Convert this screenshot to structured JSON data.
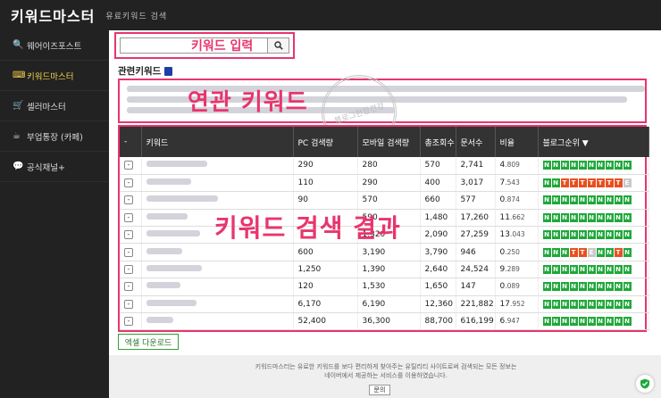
{
  "header": {
    "brand": "키워드마스터",
    "subtitle": "유료키워드 검색"
  },
  "sidebar": {
    "items": [
      {
        "label": "웨어이즈포스트",
        "icon": "search-icon"
      },
      {
        "label": "키워드마스터",
        "icon": "keyboard-icon",
        "active": true
      },
      {
        "label": "셀러마스터",
        "icon": "cart-icon"
      },
      {
        "label": "부업통장 (카페)",
        "icon": "coffee-icon"
      },
      {
        "label": "공식채널+",
        "icon": "chat-icon"
      }
    ]
  },
  "search": {
    "placeholder": "",
    "annotation": "키워드 입력"
  },
  "related": {
    "title": "관련키워드",
    "annotation": "연관 키워드",
    "stamp_text": "블로그한장건강"
  },
  "table": {
    "annotation": "키워드 검색 결과",
    "headers": [
      "-",
      "키워드",
      "PC 검색량",
      "모바일 검색량",
      "총조회수",
      "문서수",
      "비율",
      "블로그순위 ▼"
    ],
    "rows": [
      {
        "pc": "290",
        "mobile": "280",
        "total": "570",
        "docs": "2,741",
        "ratio_int": "4",
        "ratio_frac": ".809",
        "ranks": "NNNNNNNNNN"
      },
      {
        "pc": "110",
        "mobile": "290",
        "total": "400",
        "docs": "3,017",
        "ratio_int": "7",
        "ratio_frac": ".543",
        "ranks": "NNTTTTTTTE"
      },
      {
        "pc": "90",
        "mobile": "570",
        "total": "660",
        "docs": "577",
        "ratio_int": "0",
        "ratio_frac": ".874",
        "ranks": "NNNNNNNNNN"
      },
      {
        "pc": "",
        "mobile": "590",
        "total": "1,480",
        "docs": "17,260",
        "ratio_int": "11",
        "ratio_frac": ".662",
        "ranks": "NNNNNNNNNN"
      },
      {
        "pc": "",
        "mobile": "1,320",
        "total": "2,090",
        "docs": "27,259",
        "ratio_int": "13",
        "ratio_frac": ".043",
        "ranks": "NNNNNNNNNN"
      },
      {
        "pc": "600",
        "mobile": "3,190",
        "total": "3,790",
        "docs": "946",
        "ratio_int": "0",
        "ratio_frac": ".250",
        "ranks": "NNNTTENNTN"
      },
      {
        "pc": "1,250",
        "mobile": "1,390",
        "total": "2,640",
        "docs": "24,524",
        "ratio_int": "9",
        "ratio_frac": ".289",
        "ranks": "NNNNNNNNNN"
      },
      {
        "pc": "120",
        "mobile": "1,530",
        "total": "1,650",
        "docs": "147",
        "ratio_int": "0",
        "ratio_frac": ".089",
        "ranks": "NNNNNNNNNN"
      },
      {
        "pc": "6,170",
        "mobile": "6,190",
        "total": "12,360",
        "docs": "221,882",
        "ratio_int": "17",
        "ratio_frac": ".952",
        "ranks": "NNNNNNNNNN"
      },
      {
        "pc": "52,400",
        "mobile": "36,300",
        "total": "88,700",
        "docs": "616,199",
        "ratio_int": "6",
        "ratio_frac": ".947",
        "ranks": "NNNNNNNNNN"
      }
    ]
  },
  "excel_button": "엑셀 다운로드",
  "footer": {
    "text": "키워드마스터는 유료한 키워드를 보다 편리하게 찾아주는 유틸리티 사이트로써 검색되는 모든 정보는 네이버에서 제공하는 서비스를 이용하였습니다.",
    "ask_button": "문의"
  },
  "colors": {
    "accent": "#e8356d",
    "rank_N": "#1fa83a",
    "rank_T": "#e8501f",
    "rank_E": "#c8c8c8",
    "active": "#f1d04b"
  }
}
